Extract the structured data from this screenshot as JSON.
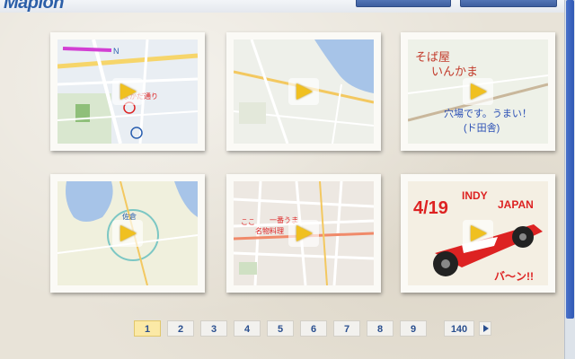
{
  "header": {
    "logo_text": "Mapion",
    "buttons": [
      "",
      ""
    ]
  },
  "gallery": {
    "tiles": [
      {
        "name": "map-drawing-1",
        "annotation": ""
      },
      {
        "name": "map-drawing-2",
        "annotation": ""
      },
      {
        "name": "map-drawing-3",
        "annotation": "そば屋 いんかま 穴場です。うまい！(ド田舎)"
      },
      {
        "name": "map-drawing-4",
        "annotation": ""
      },
      {
        "name": "map-drawing-5",
        "annotation": ""
      },
      {
        "name": "map-drawing-6",
        "annotation": "4/19 INDY JAPAN"
      }
    ],
    "play_icon": "play-icon"
  },
  "pagination": {
    "current": "1",
    "pages": [
      "1",
      "2",
      "3",
      "4",
      "5",
      "6",
      "7",
      "8",
      "9"
    ],
    "last": "140",
    "next_icon": "next-arrow-icon"
  },
  "colors": {
    "accent": "#2c5fa8",
    "current_page_bg": "#fbe9a6",
    "play_triangle": "#f0c020"
  }
}
